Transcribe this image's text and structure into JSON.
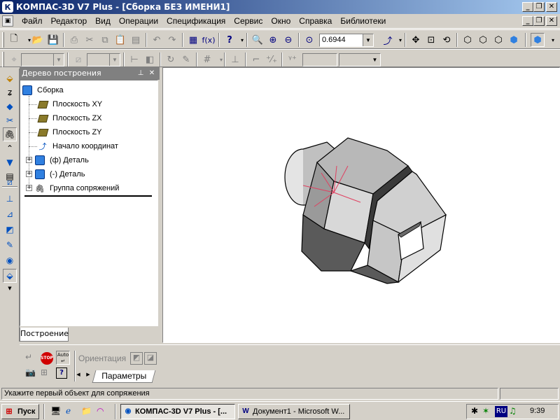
{
  "app": {
    "title": "КОМПАС-3D V7 Plus - [Сборка БЕЗ ИМЕНИ1]",
    "min_glyph": "_",
    "restore_glyph": "❐",
    "close_glyph": "✕"
  },
  "menu": {
    "items": [
      {
        "label": "Файл"
      },
      {
        "label": "Редактор"
      },
      {
        "label": "Вид"
      },
      {
        "label": "Операции"
      },
      {
        "label": "Спецификация"
      },
      {
        "label": "Сервис"
      },
      {
        "label": "Окно"
      },
      {
        "label": "Справка"
      },
      {
        "label": "Библиотеки"
      }
    ]
  },
  "toolbar": {
    "zoom_value": "0.6944",
    "icons": [
      "new-file-icon",
      "open-icon",
      "save-icon",
      "print-icon",
      "cut-icon",
      "copy-icon",
      "paste-icon",
      "undo-icon",
      "redo-icon",
      "properties-icon",
      "variables-icon",
      "help-icon",
      "zoom-window-icon",
      "zoom-in-icon",
      "zoom-out-icon",
      "zoom-scale-icon",
      "orientation-icon",
      "pan-icon",
      "zoom-fit-icon",
      "rotate-icon",
      "wireframe-icon",
      "hidden-lines-icon",
      "hidden-thin-icon",
      "shaded-icon",
      "perspective-icon"
    ]
  },
  "tree": {
    "header": "Дерево построения",
    "pin_glyph": "⊥",
    "close_glyph": "✕",
    "nodes": [
      {
        "label": "Сборка"
      },
      {
        "label": "Плоскость XY"
      },
      {
        "label": "Плоскость ZX"
      },
      {
        "label": "Плоскость ZY"
      },
      {
        "label": "Начало координат"
      },
      {
        "label": "(ф) Деталь"
      },
      {
        "label": "(-) Деталь"
      },
      {
        "label": "Группа сопряжений"
      }
    ],
    "tab_label": "Построение"
  },
  "properties": {
    "orientation_label": "Ориентация",
    "params_tab": "Параметры",
    "stop_label": "STOP",
    "auto_label": "Auto"
  },
  "status": {
    "message": "Укажите первый объект для сопряжения"
  },
  "taskbar": {
    "start_label": "Пуск",
    "tasks": [
      {
        "label": "КОМПАС-3D V7 Plus - [..."
      },
      {
        "label": "Документ1 - Microsoft W..."
      }
    ],
    "lang": "RU",
    "time": "9:39"
  },
  "colors": {
    "titlebar_start": "#0a246a",
    "titlebar_end": "#a6caf0",
    "face": "#d4d0c8",
    "model_light": "#c8c8c8",
    "model_dark": "#5a5a5a",
    "axis_color": "#e04060"
  }
}
